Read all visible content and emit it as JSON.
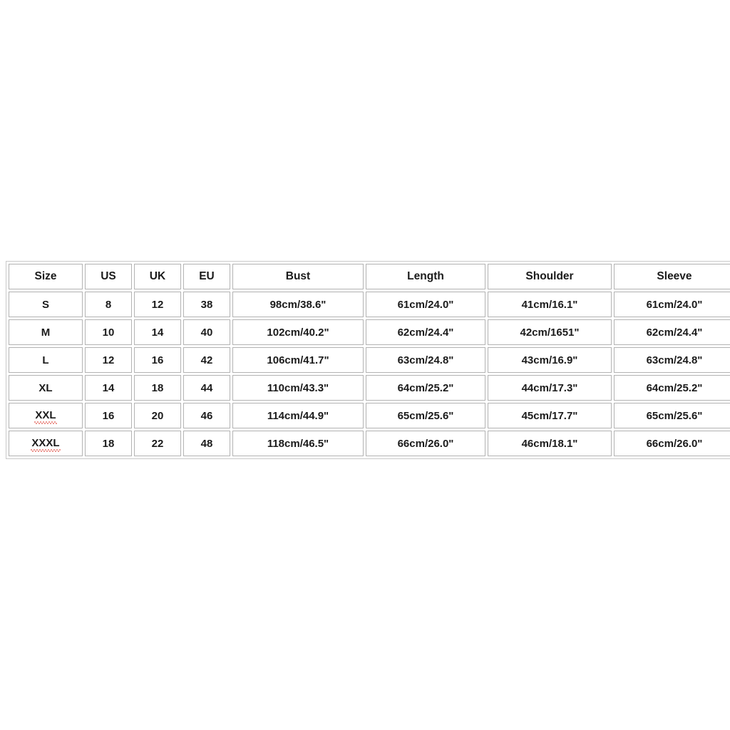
{
  "table": {
    "name": "size-chart",
    "columns": [
      "Size",
      "US",
      "UK",
      "EU",
      "Bust",
      "Length",
      "Shoulder",
      "Sleeve"
    ],
    "rows": [
      {
        "size": "S",
        "size_misspelled": false,
        "us": "8",
        "uk": "12",
        "eu": "38",
        "bust": "98cm/38.6\"",
        "length": "61cm/24.0\"",
        "shoulder": "41cm/16.1\"",
        "sleeve": "61cm/24.0\""
      },
      {
        "size": "M",
        "size_misspelled": false,
        "us": "10",
        "uk": "14",
        "eu": "40",
        "bust": "102cm/40.2\"",
        "length": "62cm/24.4\"",
        "shoulder": "42cm/1651\"",
        "sleeve": "62cm/24.4\""
      },
      {
        "size": "L",
        "size_misspelled": false,
        "us": "12",
        "uk": "16",
        "eu": "42",
        "bust": "106cm/41.7\"",
        "length": "63cm/24.8\"",
        "shoulder": "43cm/16.9\"",
        "sleeve": "63cm/24.8\""
      },
      {
        "size": "XL",
        "size_misspelled": false,
        "us": "14",
        "uk": "18",
        "eu": "44",
        "bust": "110cm/43.3\"",
        "length": "64cm/25.2\"",
        "shoulder": "44cm/17.3\"",
        "sleeve": "64cm/25.2\""
      },
      {
        "size": "XXL",
        "size_misspelled": true,
        "us": "16",
        "uk": "20",
        "eu": "46",
        "bust": "114cm/44.9\"",
        "length": "65cm/25.6\"",
        "shoulder": "45cm/17.7\"",
        "sleeve": "65cm/25.6\""
      },
      {
        "size": "XXXL",
        "size_misspelled": true,
        "us": "18",
        "uk": "22",
        "eu": "48",
        "bust": "118cm/46.5\"",
        "length": "66cm/26.0\"",
        "shoulder": "46cm/18.1\"",
        "sleeve": "66cm/26.0\""
      }
    ]
  },
  "colors": {
    "background": "#ffffff",
    "cell_border": "#b3b3b3",
    "outer_border": "#c9c9c9",
    "text": "#1b1b1b",
    "spellcheck_underline": "#d93025"
  }
}
